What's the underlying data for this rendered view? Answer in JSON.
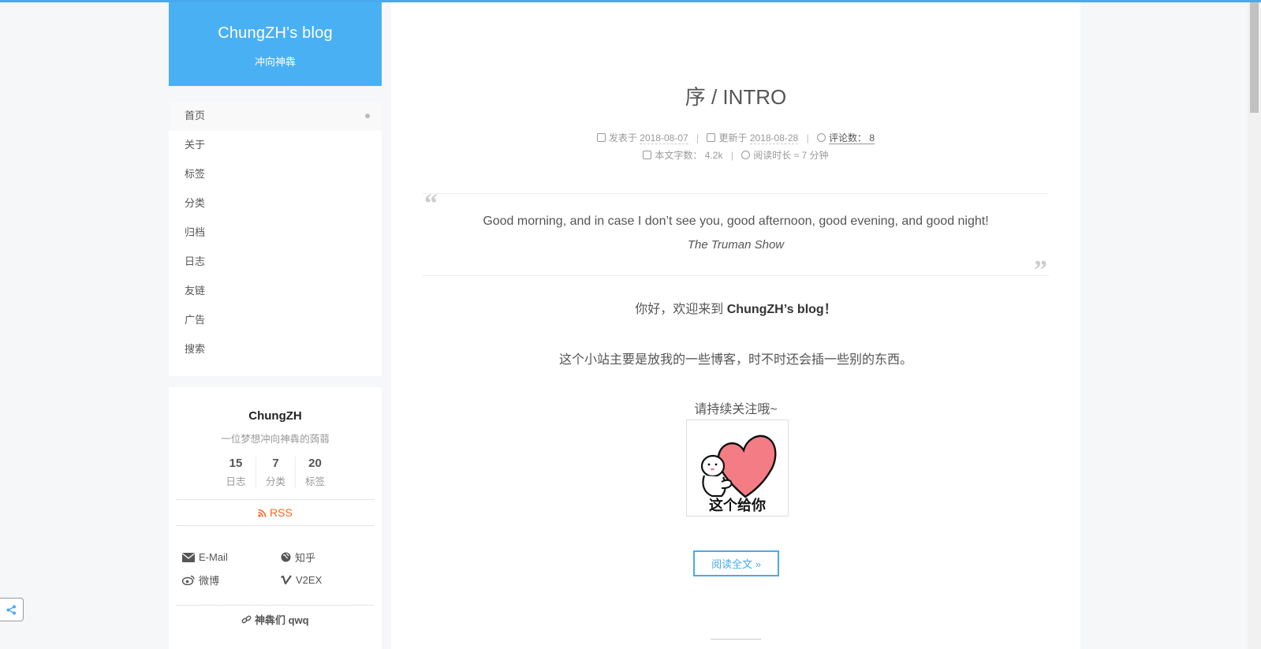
{
  "brand": {
    "title": "ChungZH's blog",
    "subtitle": "冲向神犇"
  },
  "menu": {
    "items": [
      {
        "label": "首页"
      },
      {
        "label": "关于"
      },
      {
        "label": "标签"
      },
      {
        "label": "分类"
      },
      {
        "label": "归档"
      },
      {
        "label": "日志"
      },
      {
        "label": "友链"
      },
      {
        "label": "广告"
      },
      {
        "label": "搜索"
      }
    ]
  },
  "profile": {
    "name": "ChungZH",
    "description": "一位梦想冲向神犇的蒟蒻",
    "stats": [
      {
        "num": "15",
        "label": "日志"
      },
      {
        "num": "7",
        "label": "分类"
      },
      {
        "num": "20",
        "label": "标签"
      }
    ],
    "rss": "RSS",
    "links": [
      {
        "label": "E-Mail",
        "icon": "envelope-icon"
      },
      {
        "label": "知乎",
        "icon": "globe-icon"
      },
      {
        "label": "微博",
        "icon": "weibo-icon"
      },
      {
        "label": "V2EX",
        "icon": "vimeo-icon"
      }
    ],
    "friends": "神犇们 qwq"
  },
  "post": {
    "title": "序 / INTRO",
    "meta": {
      "published_label": "发表于",
      "published_date": "2018-08-07",
      "updated_label": "更新于",
      "updated_date": "2018-08-28",
      "comments": "评论数： 8",
      "wordcount_label": "本文字数：",
      "wordcount": "4.2k",
      "readtime_label": "阅读时长 ≈",
      "readtime": "7 分钟"
    },
    "quote": {
      "text": "Good morning, and in case I don’t see you, good afternoon, good evening, and good night!",
      "source": "The Truman Show"
    },
    "greeting_prefix": "你好，欢迎来到 ",
    "greeting_bold": "ChungZH’s blog！",
    "intro": "这个小站主要是放我的一些博客，时不时还会插一些别的东西。",
    "follow": "请持续关注哦~",
    "sticker_text": "这个给你",
    "readmore": "阅读全文 »"
  },
  "colors": {
    "accent": "#49a9ee",
    "brand_bg": "#4ab0f4",
    "rss": "#fc6423",
    "heart": "#f47c84"
  }
}
